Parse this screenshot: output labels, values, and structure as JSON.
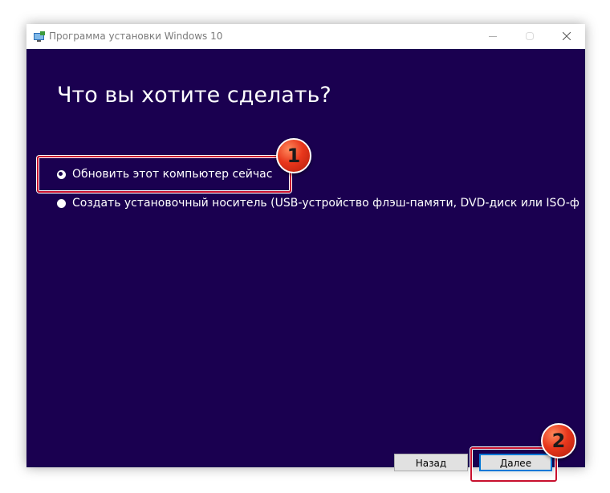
{
  "window": {
    "title": "Программа установки Windows 10"
  },
  "main": {
    "heading": "Что вы хотите сделать?",
    "options": [
      {
        "label": "Обновить этот компьютер сейчас",
        "checked": true
      },
      {
        "label": "Создать установочный носитель (USB-устройство флэш-памяти, DVD-диск или ISO-ф",
        "checked": false
      }
    ]
  },
  "footer": {
    "back_label": "Назад",
    "next_label": "Далее"
  },
  "annotations": {
    "badge_1": "1",
    "badge_2": "2"
  },
  "colors": {
    "background": "#1a0050",
    "highlight": "#c8102e",
    "badge": "#e8371c",
    "focus": "#0078d7"
  }
}
